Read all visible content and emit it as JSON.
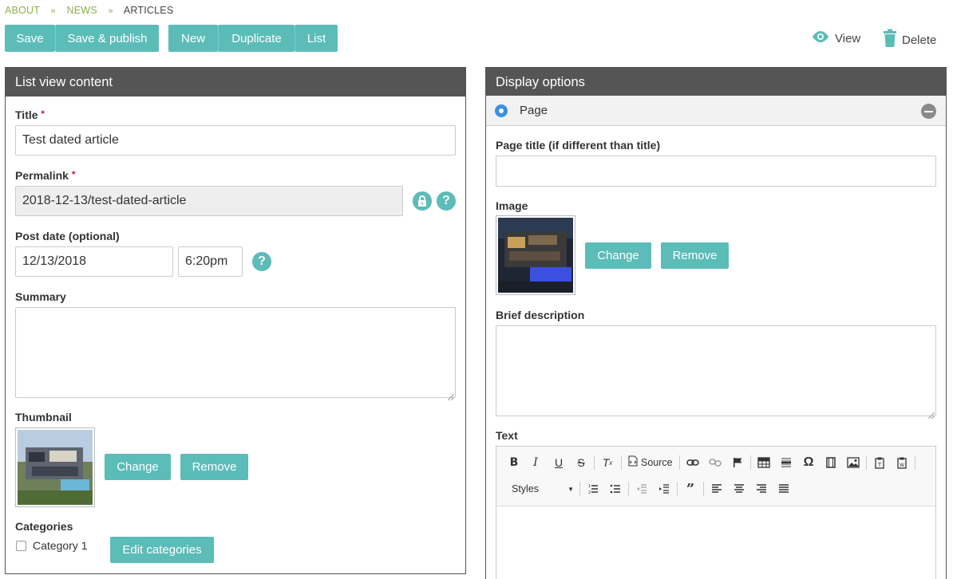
{
  "breadcrumb": {
    "items": [
      "ABOUT",
      "NEWS"
    ],
    "separator": "»",
    "current": "ARTICLES"
  },
  "toolbar": {
    "save": "Save",
    "save_publish": "Save & publish",
    "new": "New",
    "duplicate": "Duplicate",
    "list": "List",
    "view": "View",
    "delete": "Delete"
  },
  "left_panel": {
    "title": "List view content",
    "title_label": "Title",
    "title_value": "Test dated article",
    "permalink_label": "Permalink",
    "permalink_value": "2018-12-13/test-dated-article",
    "post_date_label": "Post date (optional)",
    "date_value": "12/13/2018",
    "time_value": "6:20pm",
    "summary_label": "Summary",
    "summary_value": "",
    "thumbnail_label": "Thumbnail",
    "change": "Change",
    "remove": "Remove",
    "categories_label": "Categories",
    "category_1": "Category 1",
    "edit_categories": "Edit categories",
    "required_mark": "*",
    "help_glyph": "?"
  },
  "right_panel": {
    "title": "Display options",
    "page_option": "Page",
    "page_title_label": "Page title (if different than title)",
    "page_title_value": "",
    "image_label": "Image",
    "change": "Change",
    "remove": "Remove",
    "brief_label": "Brief description",
    "brief_value": "",
    "text_label": "Text",
    "rte": {
      "source": "Source",
      "styles": "Styles"
    }
  },
  "colors": {
    "accent": "#5bbcb8",
    "panel_header": "#555555",
    "breadcrumb_link": "#8bb04a",
    "radio": "#3b8fe5"
  }
}
